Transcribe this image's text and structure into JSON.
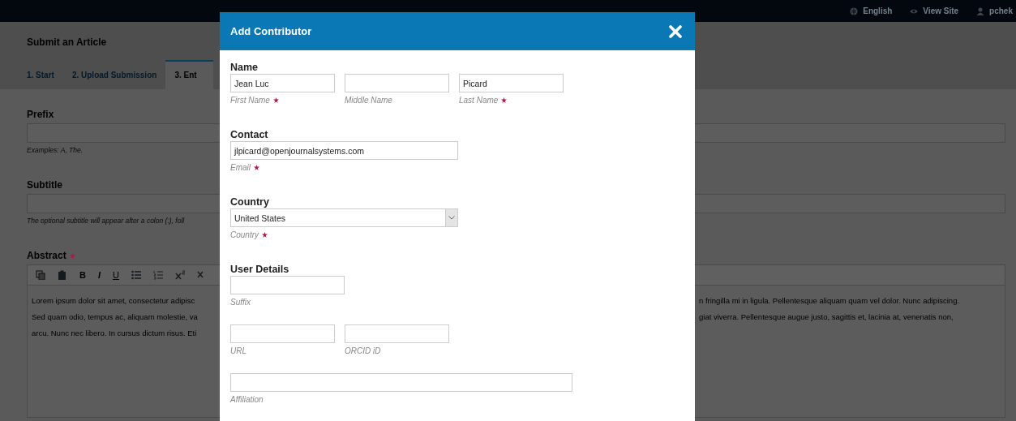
{
  "topbar": {
    "links": [
      {
        "kind": "language",
        "label": "English"
      },
      {
        "kind": "view",
        "label": "View Site"
      },
      {
        "kind": "user",
        "label": "pchek"
      }
    ]
  },
  "page": {
    "title": "Submit an Article",
    "tabs": [
      {
        "label": "1. Start",
        "selected": false
      },
      {
        "label": "2. Upload Submission",
        "selected": false
      },
      {
        "label": "3. Ent",
        "selected": true
      }
    ]
  },
  "form": {
    "fields": [
      {
        "label": "Prefix",
        "hint": "Examples: A, The."
      },
      {
        "label": "Subtitle",
        "hint": "The optional subtitle will appear after a colon (:), foll"
      }
    ],
    "abstract": {
      "label": "Abstract",
      "required": true,
      "toolbar": [
        {
          "kind": "copy"
        },
        {
          "kind": "paste"
        },
        {
          "kind": "bold",
          "label": "B"
        },
        {
          "kind": "italic",
          "label": "I"
        },
        {
          "kind": "underline",
          "label": "U"
        },
        {
          "kind": "bullets"
        },
        {
          "kind": "numbers"
        },
        {
          "kind": "superscript"
        },
        {
          "kind": "subscript"
        }
      ],
      "lines": [
        {
          "left": "Lorem ipsum dolor sit amet, consectetur adipisc",
          "right": "n fringilla mi in ligula. Pellentesque aliquam quam vel dolor. Nunc adipiscing."
        },
        {
          "left": "Sed quam odio, tempus ac, aliquam molestie, va",
          "right": "giat viverra. Pellentesque augue justo, sagittis et, lacinia at, venenatis non,"
        },
        {
          "left": "arcu. Nunc nec libero. In cursus dictum risus. Eti"
        }
      ]
    }
  },
  "dialog": {
    "title": "Add Contributor",
    "sections": [
      {
        "heading": "Name",
        "rows": [
          [
            {
              "kind": "name",
              "value": "Jean Luc",
              "hint": "First Name",
              "required": true
            },
            {
              "kind": "name",
              "hint": "Middle Name",
              "required": false
            },
            {
              "kind": "name",
              "value": "Picard",
              "hint": "Last Name",
              "required": true
            }
          ]
        ]
      },
      {
        "heading": "Contact",
        "rows": [
          [
            {
              "kind": "email",
              "value": "jlpicard@openjournalsystems.com",
              "hint": "Email",
              "required": true
            }
          ]
        ]
      },
      {
        "heading": "Country",
        "rows": [
          [
            {
              "kind": "select",
              "value": "United States",
              "hint": "Country",
              "required": true
            }
          ]
        ]
      },
      {
        "heading": "User Details",
        "rows": [
          [
            {
              "kind": "suffix",
              "hint": "Suffix",
              "required": false
            }
          ],
          [
            {
              "kind": "url",
              "hint": "URL",
              "required": false
            },
            {
              "kind": "url",
              "hint": "ORCID iD",
              "required": false
            }
          ],
          [
            {
              "kind": "affiliation",
              "hint": "Affiliation",
              "required": false
            }
          ]
        ]
      }
    ]
  }
}
